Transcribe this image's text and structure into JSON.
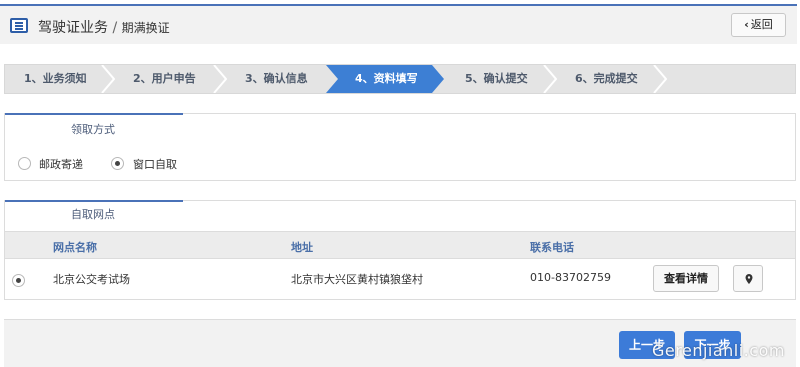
{
  "header": {
    "title": "驾驶证业务",
    "subtitle": "期满换证",
    "back_label": "返回"
  },
  "steps": [
    {
      "label": "1、业务须知",
      "active": false
    },
    {
      "label": "2、用户申告",
      "active": false
    },
    {
      "label": "3、确认信息",
      "active": false
    },
    {
      "label": "4、资料填写",
      "active": true
    },
    {
      "label": "5、确认提交",
      "active": false
    },
    {
      "label": "6、完成提交",
      "active": false
    }
  ],
  "delivery": {
    "title": "领取方式",
    "options": [
      {
        "label": "邮政寄递",
        "selected": false
      },
      {
        "label": "窗口自取",
        "selected": true
      }
    ]
  },
  "pickup": {
    "title": "自取网点",
    "columns": [
      "网点名称",
      "地址",
      "联系电话"
    ],
    "rows": [
      {
        "name": "北京公交考试场",
        "address": "北京市大兴区黄村镇狼垡村",
        "phone": "010-83702759",
        "selected": true
      }
    ],
    "detail_label": "查看详情"
  },
  "footer": {
    "prev_label": "上一步",
    "next_label": "下一步"
  },
  "watermark": "Gerenjianli.com",
  "colors": {
    "accent": "#3c7bd8",
    "step_active": "#3d7fd4",
    "tab_line": "#4a72b8"
  }
}
